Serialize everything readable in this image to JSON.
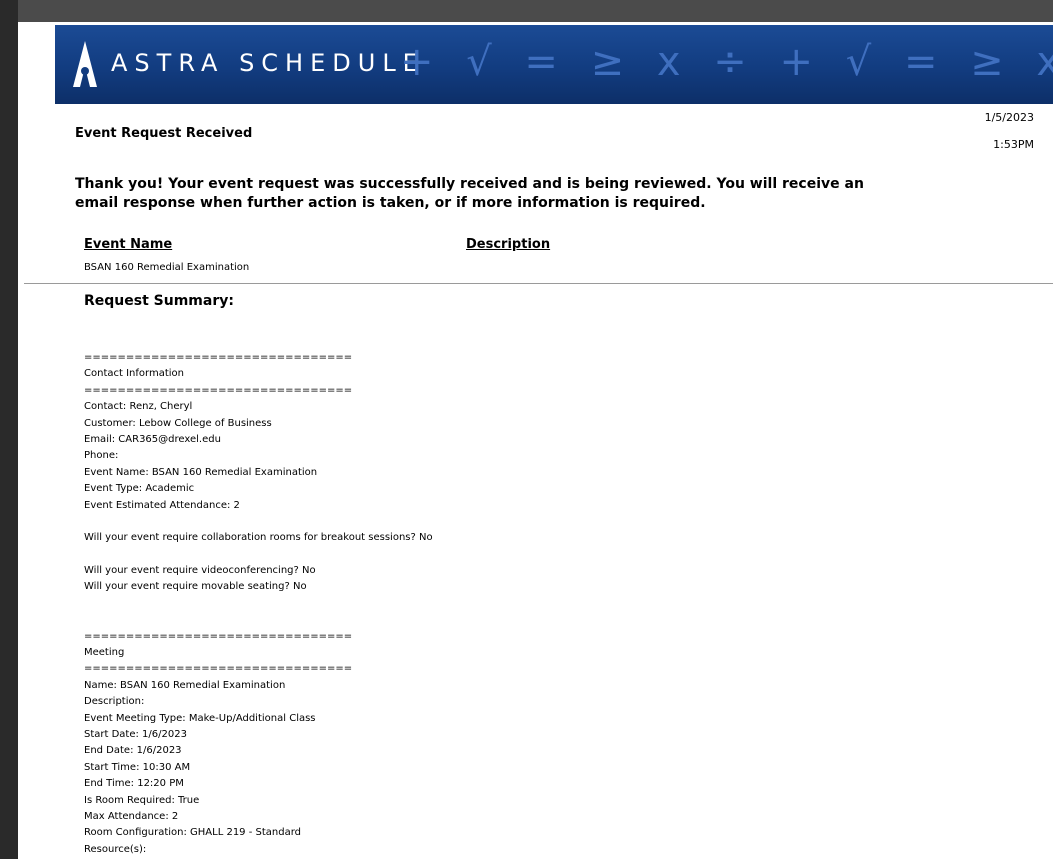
{
  "header": {
    "logo_text": "ASTRA SCHEDULE",
    "banner_symbols": "+ √ = ≥ x ÷ + √ = ≥ x ÷ + √ = ≥ x ÷"
  },
  "document": {
    "title": "Event Request Received",
    "date": "1/5/2023",
    "time": "1:53PM",
    "thank_you": "Thank you!  Your event request was successfully received and is being reviewed.  You will receive an email response when further action is taken, or if more information is required.",
    "col_event_name": "Event Name",
    "col_description": "Description",
    "event_name_value": "BSAN 160 Remedial Examination",
    "summary_title": "Request Summary:"
  },
  "summary_lines": [
    "================================",
    "Contact Information",
    "================================",
    "Contact: Renz, Cheryl",
    "Customer: Lebow College of Business",
    "Email: CAR365@drexel.edu",
    "Phone:",
    "Event Name: BSAN 160 Remedial Examination",
    "Event Type: Academic",
    "Event Estimated Attendance: 2",
    "",
    "Will your event require collaboration rooms for breakout sessions? No",
    "",
    "Will your event require videoconferencing? No",
    "Will your event require movable seating? No",
    "",
    "",
    "================================",
    "Meeting",
    "================================",
    "Name: BSAN 160 Remedial Examination",
    "Description:",
    "Event Meeting Type: Make-Up/Additional Class",
    "Start Date: 1/6/2023",
    "End Date: 1/6/2023",
    "Start Time: 10:30 AM",
    "End Time: 12:20 PM",
    "Is Room Required: True",
    "Max Attendance: 2",
    "Room Configuration: GHALL 219 - Standard",
    "Resource(s):"
  ],
  "colors": {
    "banner": "#123c80",
    "banner_symbols": "#3f6fbf",
    "frame": "#4b4b4b"
  }
}
